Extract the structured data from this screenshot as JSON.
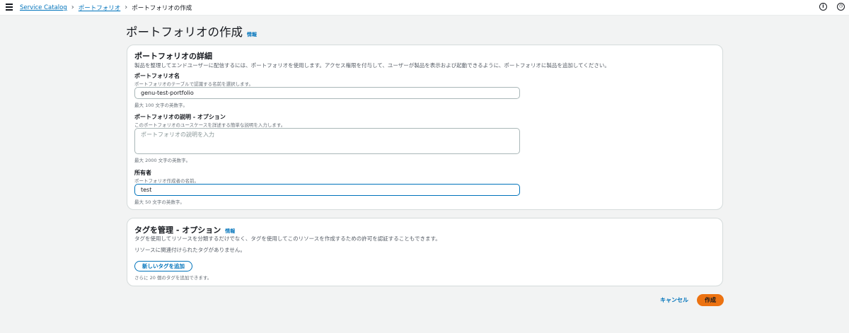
{
  "breadcrumb": {
    "root": "Service Catalog",
    "parent": "ポートフォリオ",
    "current": "ポートフォリオの作成"
  },
  "page": {
    "title": "ポートフォリオの作成",
    "info_label": "情報"
  },
  "details_panel": {
    "heading": "ポートフォリオの詳細",
    "description": "製品を整理してエンドユーザーに配信するには、ポートフォリオを使用します。アクセス権限を付与して、ユーザーが製品を表示および起動できるように、ポートフォリオに製品を追加してください。",
    "name_field": {
      "label": "ポートフォリオ名",
      "description": "ポートフォリオのテーブルで認識する名前を選択します。",
      "value": "genu-test-portfolio",
      "constraint": "最大 100 文字の英数字。"
    },
    "description_field": {
      "label": "ポートフォリオの説明 - オプション",
      "description": "このポートフォリオのユースケースを詳述する簡単な説明を入力します。",
      "placeholder": "ポートフォリオの説明を入力",
      "constraint": "最大 2000 文字の英数字。"
    },
    "owner_field": {
      "label": "所有者",
      "description": "ポートフォリオ作成者の名前。",
      "value": "test",
      "constraint": "最大 50 文字の英数字。"
    }
  },
  "tags_panel": {
    "heading": "タグを管理 - オプション",
    "info_label": "情報",
    "description": "タグを使用してリソースを分類するだけでなく、タグを使用してこのリソースを作成するための許可を認証することもできます。",
    "empty_message": "リソースに関連付けられたタグがありません。",
    "add_button_label": "新しいタグを追加",
    "remaining_note": "さらに 20 個のタグを追加できます。"
  },
  "actions": {
    "cancel_label": "キャンセル",
    "create_label": "作成"
  },
  "colors": {
    "link": "#0073bb",
    "primary_button": "#ec7211",
    "background": "#f2f3f3"
  }
}
